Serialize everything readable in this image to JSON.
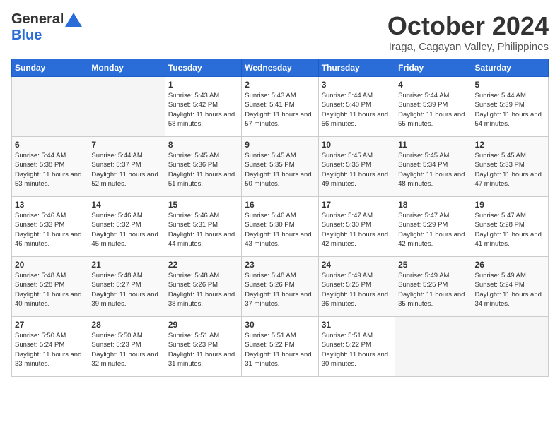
{
  "logo": {
    "general": "General",
    "blue": "Blue"
  },
  "title": "October 2024",
  "location": "Iraga, Cagayan Valley, Philippines",
  "days_of_week": [
    "Sunday",
    "Monday",
    "Tuesday",
    "Wednesday",
    "Thursday",
    "Friday",
    "Saturday"
  ],
  "weeks": [
    [
      {
        "day": "",
        "sunrise": "",
        "sunset": "",
        "daylight": "",
        "empty": true
      },
      {
        "day": "",
        "sunrise": "",
        "sunset": "",
        "daylight": "",
        "empty": true
      },
      {
        "day": "1",
        "sunrise": "Sunrise: 5:43 AM",
        "sunset": "Sunset: 5:42 PM",
        "daylight": "Daylight: 11 hours and 58 minutes.",
        "empty": false
      },
      {
        "day": "2",
        "sunrise": "Sunrise: 5:43 AM",
        "sunset": "Sunset: 5:41 PM",
        "daylight": "Daylight: 11 hours and 57 minutes.",
        "empty": false
      },
      {
        "day": "3",
        "sunrise": "Sunrise: 5:44 AM",
        "sunset": "Sunset: 5:40 PM",
        "daylight": "Daylight: 11 hours and 56 minutes.",
        "empty": false
      },
      {
        "day": "4",
        "sunrise": "Sunrise: 5:44 AM",
        "sunset": "Sunset: 5:39 PM",
        "daylight": "Daylight: 11 hours and 55 minutes.",
        "empty": false
      },
      {
        "day": "5",
        "sunrise": "Sunrise: 5:44 AM",
        "sunset": "Sunset: 5:39 PM",
        "daylight": "Daylight: 11 hours and 54 minutes.",
        "empty": false
      }
    ],
    [
      {
        "day": "6",
        "sunrise": "Sunrise: 5:44 AM",
        "sunset": "Sunset: 5:38 PM",
        "daylight": "Daylight: 11 hours and 53 minutes.",
        "empty": false
      },
      {
        "day": "7",
        "sunrise": "Sunrise: 5:44 AM",
        "sunset": "Sunset: 5:37 PM",
        "daylight": "Daylight: 11 hours and 52 minutes.",
        "empty": false
      },
      {
        "day": "8",
        "sunrise": "Sunrise: 5:45 AM",
        "sunset": "Sunset: 5:36 PM",
        "daylight": "Daylight: 11 hours and 51 minutes.",
        "empty": false
      },
      {
        "day": "9",
        "sunrise": "Sunrise: 5:45 AM",
        "sunset": "Sunset: 5:35 PM",
        "daylight": "Daylight: 11 hours and 50 minutes.",
        "empty": false
      },
      {
        "day": "10",
        "sunrise": "Sunrise: 5:45 AM",
        "sunset": "Sunset: 5:35 PM",
        "daylight": "Daylight: 11 hours and 49 minutes.",
        "empty": false
      },
      {
        "day": "11",
        "sunrise": "Sunrise: 5:45 AM",
        "sunset": "Sunset: 5:34 PM",
        "daylight": "Daylight: 11 hours and 48 minutes.",
        "empty": false
      },
      {
        "day": "12",
        "sunrise": "Sunrise: 5:45 AM",
        "sunset": "Sunset: 5:33 PM",
        "daylight": "Daylight: 11 hours and 47 minutes.",
        "empty": false
      }
    ],
    [
      {
        "day": "13",
        "sunrise": "Sunrise: 5:46 AM",
        "sunset": "Sunset: 5:33 PM",
        "daylight": "Daylight: 11 hours and 46 minutes.",
        "empty": false
      },
      {
        "day": "14",
        "sunrise": "Sunrise: 5:46 AM",
        "sunset": "Sunset: 5:32 PM",
        "daylight": "Daylight: 11 hours and 45 minutes.",
        "empty": false
      },
      {
        "day": "15",
        "sunrise": "Sunrise: 5:46 AM",
        "sunset": "Sunset: 5:31 PM",
        "daylight": "Daylight: 11 hours and 44 minutes.",
        "empty": false
      },
      {
        "day": "16",
        "sunrise": "Sunrise: 5:46 AM",
        "sunset": "Sunset: 5:30 PM",
        "daylight": "Daylight: 11 hours and 43 minutes.",
        "empty": false
      },
      {
        "day": "17",
        "sunrise": "Sunrise: 5:47 AM",
        "sunset": "Sunset: 5:30 PM",
        "daylight": "Daylight: 11 hours and 42 minutes.",
        "empty": false
      },
      {
        "day": "18",
        "sunrise": "Sunrise: 5:47 AM",
        "sunset": "Sunset: 5:29 PM",
        "daylight": "Daylight: 11 hours and 42 minutes.",
        "empty": false
      },
      {
        "day": "19",
        "sunrise": "Sunrise: 5:47 AM",
        "sunset": "Sunset: 5:28 PM",
        "daylight": "Daylight: 11 hours and 41 minutes.",
        "empty": false
      }
    ],
    [
      {
        "day": "20",
        "sunrise": "Sunrise: 5:48 AM",
        "sunset": "Sunset: 5:28 PM",
        "daylight": "Daylight: 11 hours and 40 minutes.",
        "empty": false
      },
      {
        "day": "21",
        "sunrise": "Sunrise: 5:48 AM",
        "sunset": "Sunset: 5:27 PM",
        "daylight": "Daylight: 11 hours and 39 minutes.",
        "empty": false
      },
      {
        "day": "22",
        "sunrise": "Sunrise: 5:48 AM",
        "sunset": "Sunset: 5:26 PM",
        "daylight": "Daylight: 11 hours and 38 minutes.",
        "empty": false
      },
      {
        "day": "23",
        "sunrise": "Sunrise: 5:48 AM",
        "sunset": "Sunset: 5:26 PM",
        "daylight": "Daylight: 11 hours and 37 minutes.",
        "empty": false
      },
      {
        "day": "24",
        "sunrise": "Sunrise: 5:49 AM",
        "sunset": "Sunset: 5:25 PM",
        "daylight": "Daylight: 11 hours and 36 minutes.",
        "empty": false
      },
      {
        "day": "25",
        "sunrise": "Sunrise: 5:49 AM",
        "sunset": "Sunset: 5:25 PM",
        "daylight": "Daylight: 11 hours and 35 minutes.",
        "empty": false
      },
      {
        "day": "26",
        "sunrise": "Sunrise: 5:49 AM",
        "sunset": "Sunset: 5:24 PM",
        "daylight": "Daylight: 11 hours and 34 minutes.",
        "empty": false
      }
    ],
    [
      {
        "day": "27",
        "sunrise": "Sunrise: 5:50 AM",
        "sunset": "Sunset: 5:24 PM",
        "daylight": "Daylight: 11 hours and 33 minutes.",
        "empty": false
      },
      {
        "day": "28",
        "sunrise": "Sunrise: 5:50 AM",
        "sunset": "Sunset: 5:23 PM",
        "daylight": "Daylight: 11 hours and 32 minutes.",
        "empty": false
      },
      {
        "day": "29",
        "sunrise": "Sunrise: 5:51 AM",
        "sunset": "Sunset: 5:23 PM",
        "daylight": "Daylight: 11 hours and 31 minutes.",
        "empty": false
      },
      {
        "day": "30",
        "sunrise": "Sunrise: 5:51 AM",
        "sunset": "Sunset: 5:22 PM",
        "daylight": "Daylight: 11 hours and 31 minutes.",
        "empty": false
      },
      {
        "day": "31",
        "sunrise": "Sunrise: 5:51 AM",
        "sunset": "Sunset: 5:22 PM",
        "daylight": "Daylight: 11 hours and 30 minutes.",
        "empty": false
      },
      {
        "day": "",
        "sunrise": "",
        "sunset": "",
        "daylight": "",
        "empty": true
      },
      {
        "day": "",
        "sunrise": "",
        "sunset": "",
        "daylight": "",
        "empty": true
      }
    ]
  ]
}
